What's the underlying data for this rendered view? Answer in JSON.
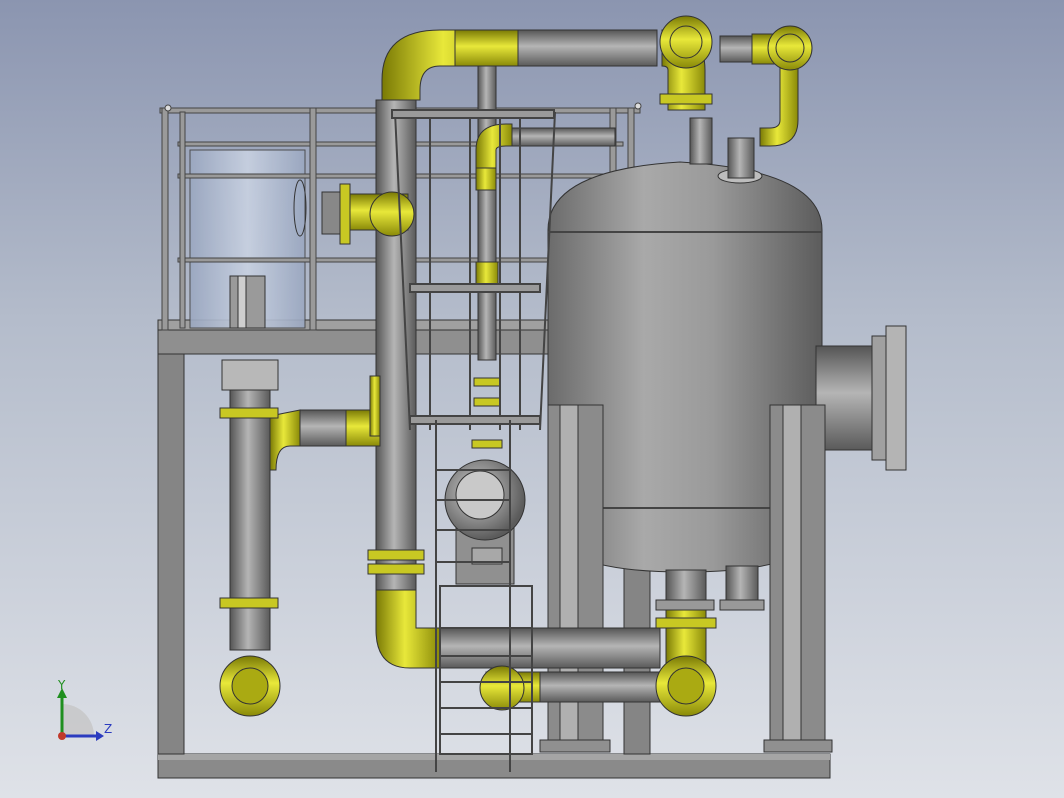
{
  "triad": {
    "y_label": "Y",
    "z_label": "Z"
  },
  "colors": {
    "pipe_yellow": "#d2d21b",
    "metal": "#8a8a8a",
    "frame": "#7d7d7d",
    "background_top": "#8b95b0",
    "background_bottom": "#dfe2e8"
  },
  "icons": {
    "triad": "coordinate-triad-icon"
  }
}
